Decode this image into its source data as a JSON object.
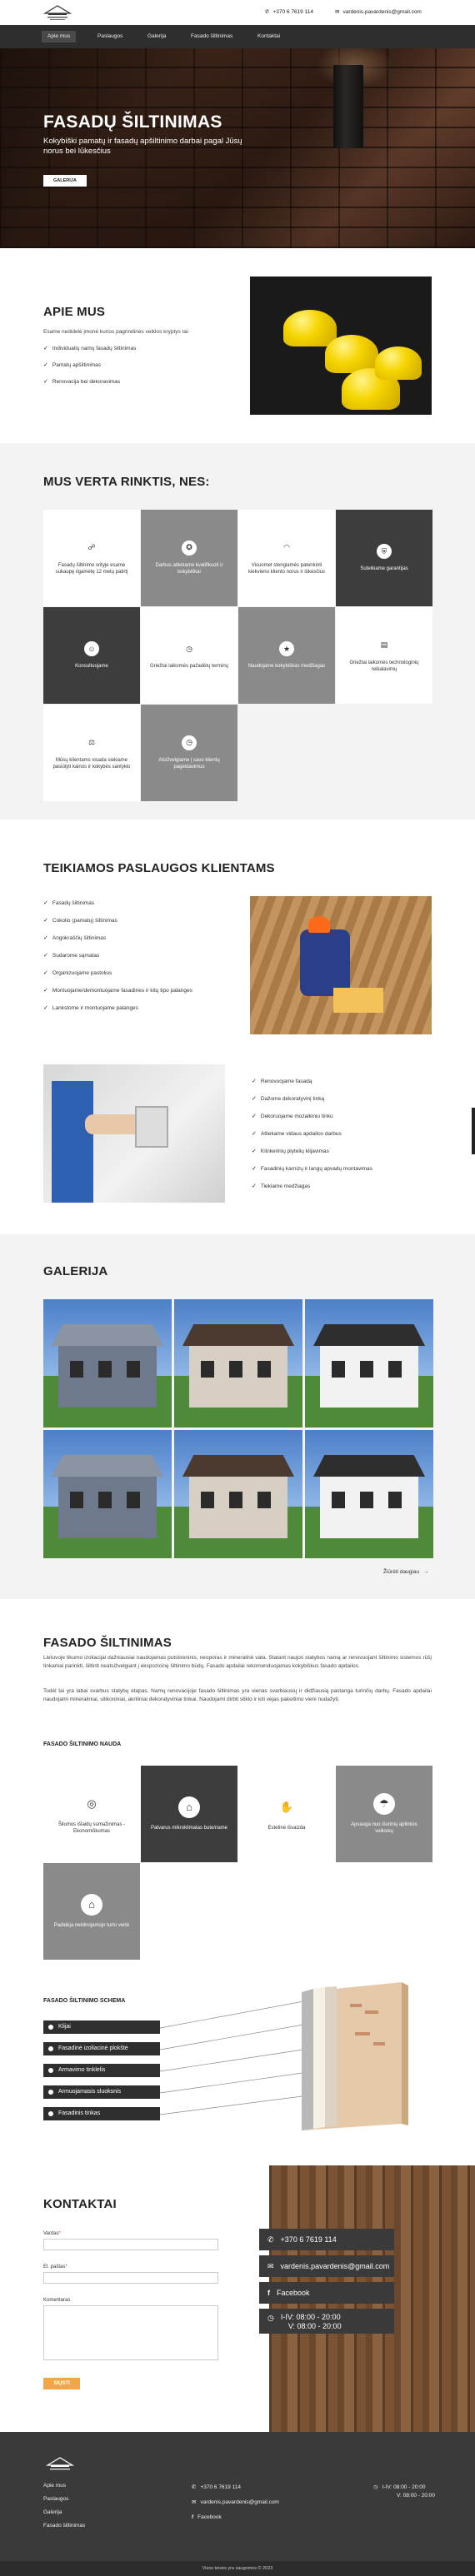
{
  "header": {
    "phone": "+370 6 7619 114",
    "email": "vardenis.pavardenis@gmail.com"
  },
  "nav": {
    "items": [
      "Apie mus",
      "Paslaugos",
      "Galerija",
      "Fasado šiltinimas",
      "Kontaktai"
    ],
    "active": "Apie mus"
  },
  "hero": {
    "title": "FASADŲ ŠILTINIMAS",
    "subtitle": "Kokybiški pamatų ir fasadų apšiltinimo darbai pagal Jūsų norus bei lūkesčius",
    "button": "GALERIJA"
  },
  "about": {
    "title": "APIE MUS",
    "intro": "Esame nedidelė įmonė kurios pagrindinės veiklos kryptys tai:",
    "items": [
      "Individualių namų fasadų šiltinimas",
      "Pamatų apšiltinimas",
      "Renovacija bei dekoravimas"
    ]
  },
  "reasons": {
    "title": "MUS VERTA RINKTIS, NES:",
    "cells": [
      {
        "text": "Fasadų šiltinimo srityje esame sukaupę ilgamėtę 12 metų patirtį",
        "style": "w",
        "icon": "handshake-icon"
      },
      {
        "text": "Darbus atliekame kvalifikuoti ir kokybiškai",
        "style": "g",
        "icon": "badge-icon"
      },
      {
        "text": "Visuomet stengiamės patenkinti kiekvieno kliento norus ir lūkesčius",
        "style": "w",
        "icon": "wifi-icon"
      },
      {
        "text": "Suteikiame garantijas",
        "style": "d",
        "icon": "shield-icon"
      },
      {
        "text": "Konsultuojame",
        "style": "d",
        "icon": "user-icon"
      },
      {
        "text": "Griežtai laikomės pažadėtų terminų",
        "style": "w",
        "icon": "clock-icon"
      },
      {
        "text": "Naudojame kokybiškas medžiagas",
        "style": "g",
        "icon": "star-icon"
      },
      {
        "text": "Griežtai laikomės technologinių reikalavimų",
        "style": "w",
        "icon": "book-icon"
      },
      {
        "text": "Mūsų klientams visada siekiame pasiūlyti kainos ir kokybės santykio",
        "style": "w",
        "icon": "scale-icon"
      },
      {
        "text": "Atsižvelgiame į savo klientų pageidavimus",
        "style": "g",
        "icon": "clock-icon"
      }
    ]
  },
  "services": {
    "title": "TEIKIAMOS PASLAUGOS KLIENTAMS",
    "left": [
      "Fasadų šiltinimas",
      "Cokolio (pamatų) šiltinimas",
      "Angokraščių šiltinimas",
      "Sudarome sąmatas",
      "Organizuojame pastolius",
      "Montuojame/demontuojame fasadines ir kitų tipo palanges",
      "Lankstome ir montuojame palanges"
    ],
    "right": [
      "Renovuojame fasadą",
      "Dažome dekoratyvinį tinką",
      "Dekoruojame mozaikiniu tinku",
      "Atliekame vidaus apdailos darbus",
      "Klinkerinių plytelių klijavimas",
      "Fasadinių karnizų ir langų apvadų montavimas",
      "Tiekiame medžiagas"
    ]
  },
  "gallery": {
    "title": "GALERIJA",
    "more": "Žiūrėti daugiau"
  },
  "facade": {
    "title": "FASADO ŠILTINIMAS",
    "p1": "Lietuvoje tikumo izoliacijai dažniausiai naudojamas putstireninis, neoporas ir mineralinė vata. Statant naujos statybos namą ar renovuojant šiltinimo sistemos rūšį tinkamai parinkti, šiltinti neatsižvelgiant į ekspozicinę šiltinimo būdų. Fasado apdailai rekomenduojamas kokybiškus fasado apdailos.",
    "p2": "Todėl tai yra labai svarbus statybų etapas. Namų renovacijoje fasado šiltinimas yra vienas svarbiausių ir didžiausią pastanga turinčių darbų. Fasado apdailai naudojami mineraliniai, silikoniniai, akriliniai dekoratyviniai tinkai. Naudojami dirbti stiklo ir kiti vėjas pakeitimo vieni nudažyti.",
    "benefits_title": "FASADO ŠILTINIMO NAUDA",
    "benefits": [
      {
        "text": "Šilumos išlaidų sumažinimas - Ekonomiškumas",
        "style": "w",
        "icon": "coin-icon"
      },
      {
        "text": "Patvarus mikroklimatas bute/name",
        "style": "d",
        "icon": "home-icon"
      },
      {
        "text": "Estetinė išvaizda",
        "style": "w",
        "icon": "hand-icon"
      },
      {
        "text": "Apsauga nuo išorinių aplinkos veiksnių",
        "style": "g",
        "icon": "umbrella-icon"
      },
      {
        "text": "Padidėja nekilnojamojo turto vertė",
        "style": "g",
        "icon": "house-icon"
      }
    ],
    "scheme_title": "FASADO ŠILTINIMO SCHEMA",
    "layers": [
      "Klijai",
      "Fasadinė izoliacinė plokštė",
      "Armavimo tinklelis",
      "Armuojamasis sluoksnis",
      "Fasadinis tinkas"
    ]
  },
  "contact": {
    "title": "KONTAKTAI",
    "name_label": "Vardas",
    "email_label": "El. paštas",
    "comment_label": "Komentaras",
    "send": "SIŲSTI",
    "phone": "+370 6 7619 114",
    "email": "vardenis.pavardenis@gmail.com",
    "facebook": "Facebook",
    "hours_1": "I-IV: 08:00 - 20:00",
    "hours_2": "V: 08:00 - 20:00"
  },
  "footer": {
    "links": [
      "Apie mus",
      "Paslaugos",
      "Galerija",
      "Fasado šiltinimas"
    ],
    "phone": "+370 6 7619 114",
    "email": "vardenis.pavardenis@gmail.com",
    "facebook": "Facebook",
    "hours_1": "I-IV: 08:00 - 20:00",
    "hours_2": "V: 08:00 - 20:00",
    "copyright": "Visos teisės yra saugomos  ©  2023"
  },
  "colors": {
    "dark": "#3d3d3d",
    "gray": "#8a8a8a",
    "accent": "#f2a54b",
    "footer": "#3a3a3a"
  }
}
